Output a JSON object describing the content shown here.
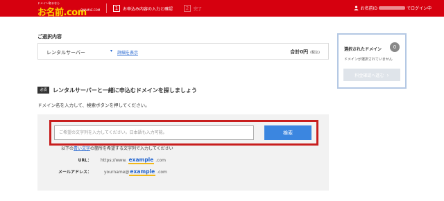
{
  "header": {
    "logo": {
      "tagline": "ドメイン取るなら",
      "name": "お名前.com",
      "sub_brand": "ONAMAE.COM"
    },
    "steps": [
      {
        "number": "1",
        "label": "お申込み内容の入力と確認",
        "active": true
      },
      {
        "number": "2",
        "label": "完了",
        "active": false
      }
    ],
    "user_status": {
      "prefix": "お名前ID",
      "suffix": "でログイン中"
    }
  },
  "selection": {
    "title": "ご選択内容",
    "item": "レンタルサーバー",
    "detail_link": "詳細を表示",
    "total": "合計0円",
    "tax": "(税込)"
  },
  "side_panel": {
    "title": "選択されたドメイン",
    "count": "0",
    "empty_message": "ドメインが選択されていません",
    "confirm_button": "料金確認へ進む"
  },
  "domain_search": {
    "required_badge": "必須",
    "heading": "レンタルサーバーと一緒に申込むドメインを探しましょう",
    "instruction": "ドメイン名を入力して、検索ボタンを押してください。",
    "input_placeholder": "ご希望の文字列を入力してください。日本語も入力可能。",
    "input_value": "",
    "search_button": "検索",
    "hint_prefix": "以下の",
    "hint_blue": "青い文字",
    "hint_suffix": "の箇所を希望する文字列で入力してください",
    "examples": [
      {
        "label": "URL：",
        "prefix": "https://www.",
        "example": "example",
        "suffix": ".com"
      },
      {
        "label": "メールアドレス：",
        "prefix": "yourname@",
        "example": "example",
        "suffix": ".com"
      }
    ]
  },
  "colors": {
    "brand_red": "#d6000f",
    "logo_yellow": "#ffd400",
    "search_blue": "#3b86e0",
    "highlight_red": "#c81e1e",
    "panel_border": "#b4c8e4"
  }
}
